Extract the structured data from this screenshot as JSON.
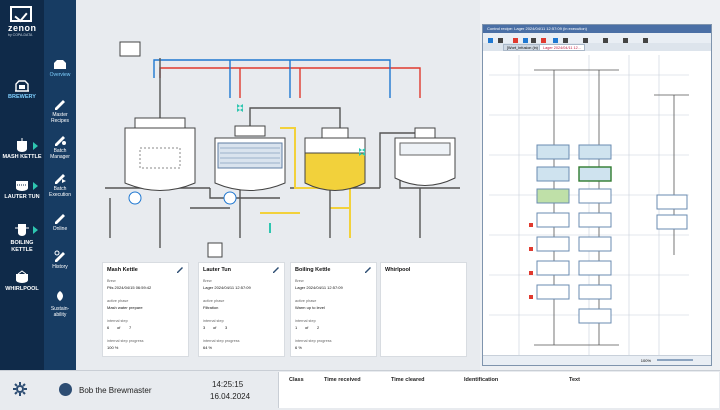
{
  "brand": {
    "name": "zenon",
    "sub": "by COPA-DATA"
  },
  "nav_main": [
    {
      "label": "BREWERY",
      "icon": "brewery-icon",
      "selected": true
    },
    {
      "label": "MASH KETTLE",
      "icon": "mash-kettle-icon"
    },
    {
      "label": "LAUTER TUN",
      "icon": "lauter-tun-icon"
    },
    {
      "label": "BOILING KETTLE",
      "icon": "boiling-kettle-icon"
    },
    {
      "label": "WHIRLPOOL",
      "icon": "whirlpool-icon"
    }
  ],
  "nav_sub": [
    {
      "label": "Overview",
      "icon": "overview-icon",
      "selected": true
    },
    {
      "label": "Master Recipes",
      "icon": "master-recipes-icon"
    },
    {
      "label": "Batch Manager",
      "icon": "batch-manager-icon"
    },
    {
      "label": "Batch Execution",
      "icon": "batch-execution-icon"
    },
    {
      "label": "Online",
      "icon": "online-icon"
    },
    {
      "label": "History",
      "icon": "history-icon"
    },
    {
      "label": "Sustain- ability",
      "icon": "sustainability-icon"
    }
  ],
  "cards": [
    {
      "title": "Mash Kettle",
      "s1": "Brew",
      "v1": "Pils 2024/04/15 06:59:42",
      "s2": "active phase",
      "v2": "Mash water prepare",
      "s3": "internal step",
      "v3a": "6",
      "v3b": "of",
      "v3c": "7",
      "s4": "internal step progress",
      "v4": "100 %"
    },
    {
      "title": "Lauter Tun",
      "s1": "Brew",
      "v1": "Lager 2024/04/11 12:57:09",
      "s2": "active phase",
      "v2": "Filtration",
      "s3": "internal step",
      "v3a": "3",
      "v3b": "of",
      "v3c": "3",
      "s4": "internal step progress",
      "v4": "64 %"
    },
    {
      "title": "Boiling Kettle",
      "s1": "Brew",
      "v1": "Lager 2024/04/11 12:57:09",
      "s2": "active phase",
      "v2": "Warm up to level",
      "s3": "internal step",
      "v3a": "1",
      "v3b": "of",
      "v3c": "2",
      "s4": "internal step progress",
      "v4": "6 %"
    },
    {
      "title": "Whirlpool"
    }
  ],
  "batch_window": {
    "title": "Control recipe: Lager 2024/04/11 12:57:09 (in execution)",
    "tabs": [
      "[Wort_Infusion (in)",
      "Lager 2024/04/11 12..."
    ],
    "zoom": "100%"
  },
  "colors": {
    "accent": "#2ec6b0",
    "hot": "#e03a2f",
    "cold": "#1f78d1",
    "wort": "#f2d13b",
    "rail": "#0f2a49"
  },
  "footer": {
    "user": "Bob the Brewmaster",
    "time": "14:25:15",
    "date": "16.04.2024",
    "alarm_cols": [
      "Class",
      "Time received",
      "Time cleared",
      "Identification",
      "Text"
    ]
  }
}
